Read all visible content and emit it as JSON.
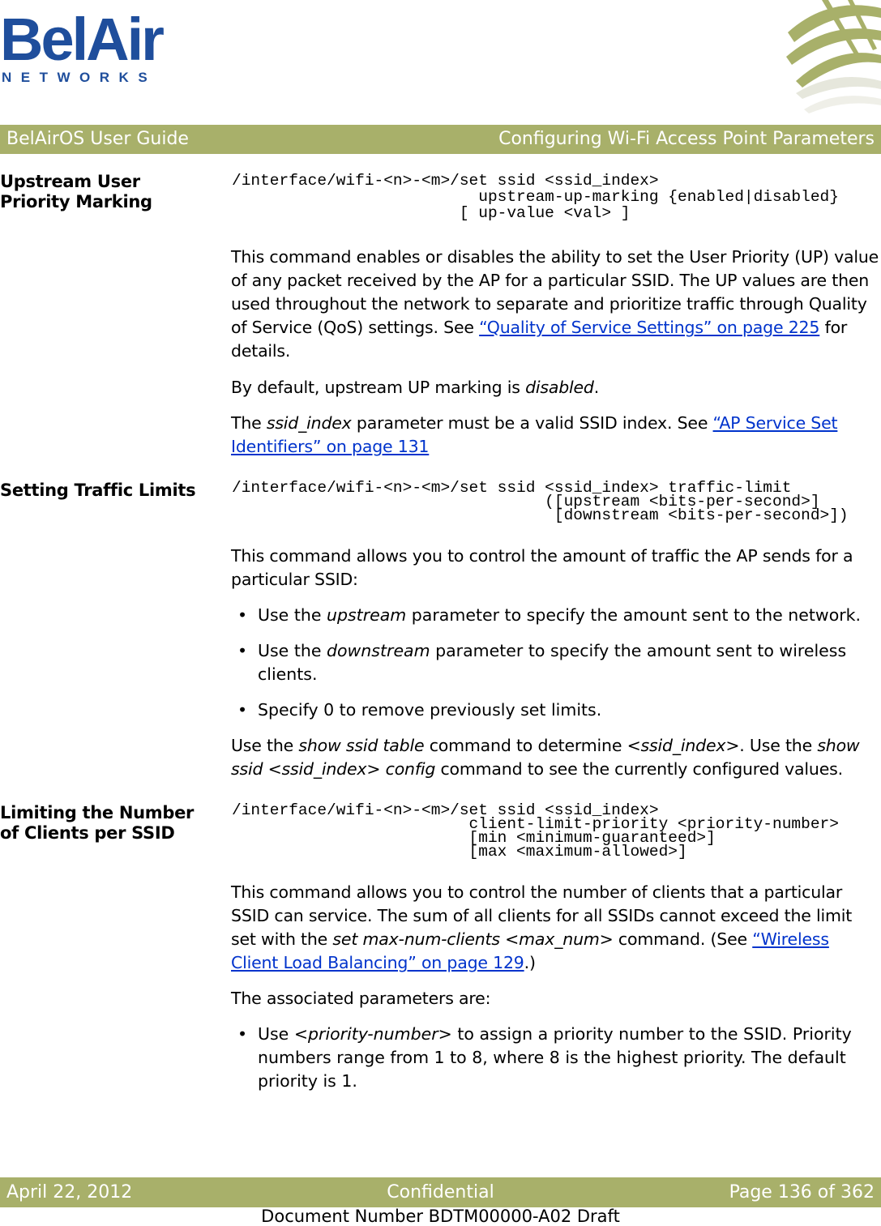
{
  "logo": {
    "main": "BelAir",
    "sub": "NETWORKS"
  },
  "header": {
    "left": "BelAirOS User Guide",
    "right": "Configuring Wi-Fi Access Point Parameters",
    "color": "#a8b06a"
  },
  "sections": [
    {
      "title": "Upstream User Priority Marking",
      "code": "/interface/wifi-<n>-<m>/set ssid <ssid_index>\n                          upstream-up-marking {enabled|disabled}\n                        [ up-value <val> ]",
      "p1_a": "This command enables or disables the ability to set the User Priority (UP) value of any packet received by the AP for a particular SSID. The UP values are then used throughout the network to separate and prioritize traffic through Quality of Service (QoS) settings. See ",
      "p1_link": "“Quality of Service Settings” on page 225",
      "p1_b": " for details.",
      "p2_a": "By default, upstream UP marking is ",
      "p2_i": "disabled",
      "p2_b": ".",
      "p3_a": "The ",
      "p3_i": "ssid_index",
      "p3_b": " parameter must be a valid SSID index. See ",
      "p3_link": "“AP Service Set Identifiers” on page 131"
    },
    {
      "title": "Setting Traffic Limits",
      "code": "/interface/wifi-<n>-<m>/set ssid <ssid_index> traffic-limit\n                                 ([upstream <bits-per-second>]\n                                  [downstream <bits-per-second>])",
      "p1": "This command allows you to control the amount of traffic the AP sends for a particular SSID:",
      "bullets": [
        {
          "a": "Use the ",
          "i": "upstream",
          "b": " parameter to specify the amount sent to the network."
        },
        {
          "a": "Use the ",
          "i": "downstream",
          "b": " parameter to specify the amount sent to wireless clients."
        },
        {
          "a": "Specify 0 to remove previously set limits.",
          "i": "",
          "b": ""
        }
      ],
      "p2_a": "Use the ",
      "p2_i1": "show ssid table",
      "p2_b": " command to determine ",
      "p2_i2": "<ssid_index>",
      "p2_c": ". Use the ",
      "p2_i3": "show ssid <ssid_index> config",
      "p2_d": " command to see the currently configured values."
    },
    {
      "title": "Limiting the Number of Clients per SSID",
      "code": "/interface/wifi-<n>-<m>/set ssid <ssid_index>\n                         client-limit-priority <priority-number>\n                         [min <minimum-guaranteed>]\n                         [max <maximum-allowed>]",
      "p1_a": "This command allows you to control the number of clients that a particular SSID can service. The sum of all clients for all SSIDs cannot exceed the limit set with the ",
      "p1_i": "set max-num-clients <max_num>",
      "p1_b": " command. (See ",
      "p1_link": "“Wireless Client Load Balancing” on page 129",
      "p1_c": ".)",
      "p2": "The associated parameters are:",
      "bullets": [
        {
          "a": "Use ",
          "i": "<priority-number>",
          "b": " to assign a priority number to the SSID. Priority numbers range from 1 to 8, where 8 is the highest priority. The default priority is 1."
        }
      ]
    }
  ],
  "footer": {
    "date": "April 22, 2012",
    "center": "Confidential",
    "page": "Page 136 of 362",
    "docnum": "Document Number BDTM00000-A02 Draft"
  }
}
